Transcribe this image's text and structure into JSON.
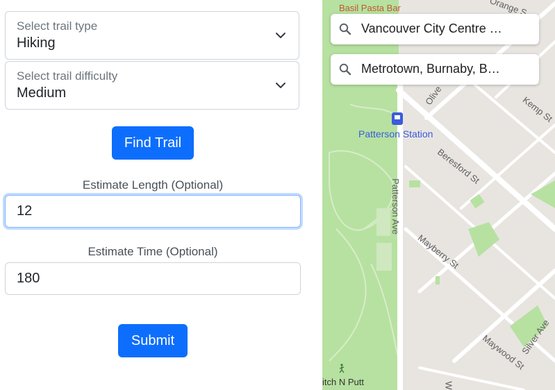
{
  "form": {
    "trail_type": {
      "label": "Select trail type",
      "value": "Hiking"
    },
    "trail_difficulty": {
      "label": "Select trail difficulty",
      "value": "Medium"
    },
    "find_button": "Find Trail",
    "length": {
      "label": "Estimate Length (Optional)",
      "value": "12"
    },
    "time": {
      "label": "Estimate Time (Optional)",
      "value": "180"
    },
    "submit_button": "Submit"
  },
  "map": {
    "search_from": "Vancouver City Centre …",
    "search_to": "Metrotown, Burnaby, B…",
    "labels": {
      "restaurant": "Basil Pasta Bar",
      "station": "Patterson Station",
      "street_olive": "Olive",
      "street_kemp": "Kemp St",
      "street_beresford": "Beresford St",
      "street_patterson": "Patterson Ave",
      "street_mayberry": "Mayberry St",
      "street_maywood": "Maywood St",
      "street_silver": "Silver Ave",
      "street_orange": "Orange S",
      "poi_putt": "itch N Putt",
      "street_w": "W"
    },
    "colors": {
      "park": "#b7e1a1",
      "road": "#ffffff",
      "land": "#e8e5e1",
      "station": "#3b5bdb",
      "restaurant": "#c0592b"
    }
  }
}
